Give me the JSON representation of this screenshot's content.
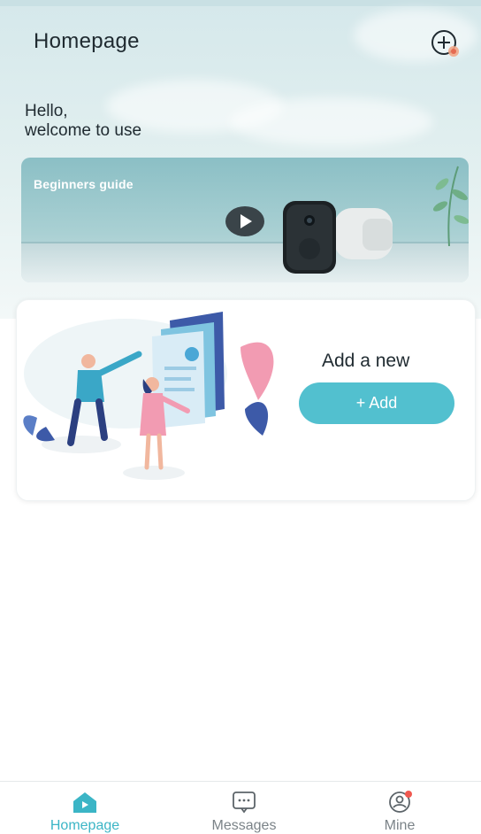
{
  "header": {
    "title": "Homepage",
    "add_icon": "plus-circle-icon"
  },
  "greeting": {
    "line1": "Hello,",
    "line2": "welcome to use"
  },
  "banner": {
    "label": "Beginners guide",
    "play_icon": "play-icon"
  },
  "add_card": {
    "heading": "Add a new",
    "button_label": "+ Add"
  },
  "nav": {
    "items": [
      {
        "label": "Homepage",
        "icon": "home-icon",
        "active": true
      },
      {
        "label": "Messages",
        "icon": "message-icon",
        "active": false
      },
      {
        "label": "Mine",
        "icon": "profile-icon",
        "active": false
      }
    ]
  },
  "colors": {
    "accent": "#52c0cf",
    "active_nav": "#3bb5c6",
    "badge": "#f0584f"
  }
}
